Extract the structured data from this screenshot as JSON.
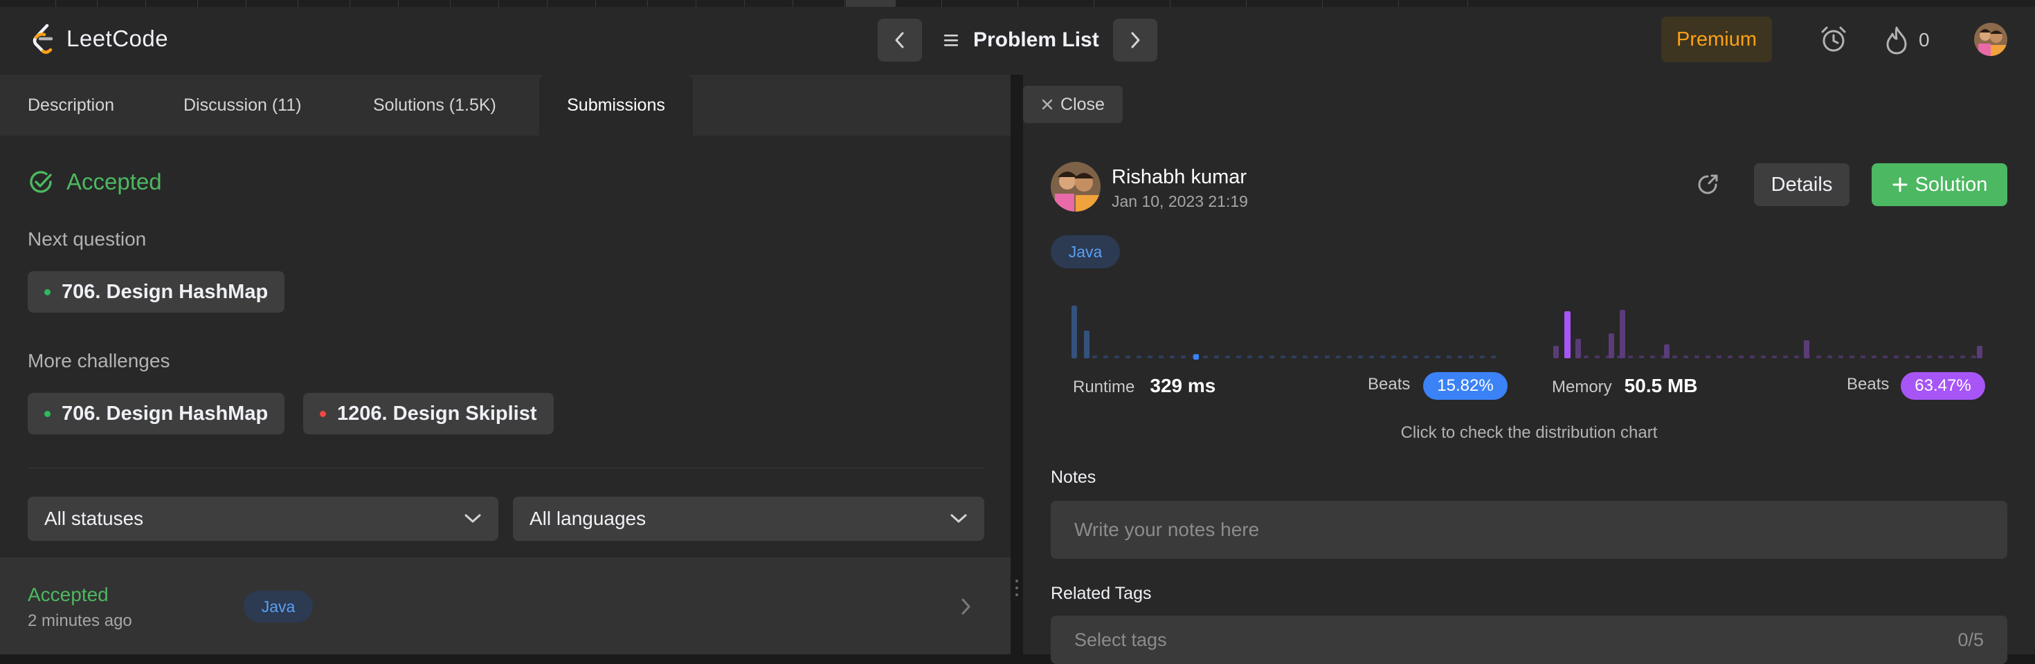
{
  "header": {
    "brand": "LeetCode",
    "problem_list": "Problem List",
    "premium": "Premium",
    "streak_count": "0"
  },
  "left_tabs": [
    {
      "label": "Description"
    },
    {
      "label": "Discussion (11)"
    },
    {
      "label": "Solutions (1.5K)"
    },
    {
      "label": "Submissions"
    }
  ],
  "status": {
    "title": "Accepted",
    "next_question_label": "Next question",
    "next_question": "706. Design HashMap",
    "more_challenges_label": "More challenges",
    "challenges": [
      {
        "title": "706. Design HashMap",
        "difficulty_color": "#2cbb5d"
      },
      {
        "title": "1206. Design Skiplist",
        "difficulty_color": "#ef4743"
      }
    ]
  },
  "filters": {
    "status": "All statuses",
    "language": "All languages"
  },
  "submission_row": {
    "status": "Accepted",
    "time": "2 minutes ago",
    "language": "Java"
  },
  "detail": {
    "close_label": "Close",
    "user_name": "Rishabh kumar",
    "date": "Jan 10, 2023 21:19",
    "details_label": "Details",
    "solution_label": "Solution",
    "language": "Java",
    "runtime_label": "Runtime",
    "runtime_value": "329 ms",
    "runtime_beats_label": "Beats",
    "runtime_beats": "15.82%",
    "memory_label": "Memory",
    "memory_value": "50.5 MB",
    "memory_beats_label": "Beats",
    "memory_beats": "63.47%",
    "distribution_hint": "Click to check the distribution chart",
    "notes_label": "Notes",
    "notes_placeholder": "Write your notes here",
    "related_tags_label": "Related Tags",
    "tags_placeholder": "Select tags",
    "tags_count": "0/5"
  },
  "colors": {
    "accent": "#ffa116",
    "accepted": "#4cb861",
    "runtime": "#3b82f6",
    "memory": "#a855f7"
  }
}
